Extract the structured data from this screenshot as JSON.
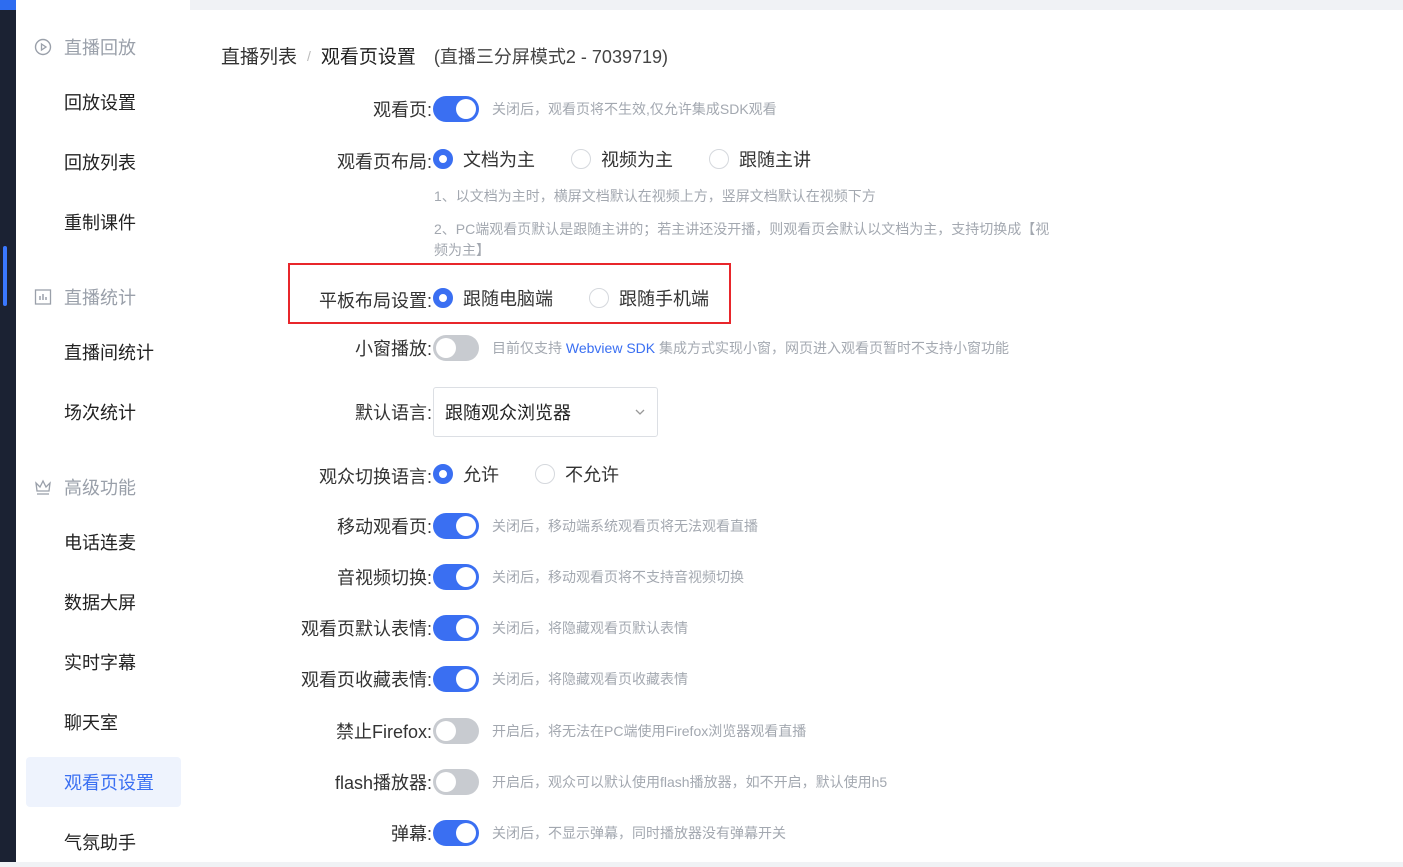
{
  "sidebar": {
    "groups": [
      {
        "label": "直播回放",
        "icon": "play-circle-icon"
      },
      {
        "label": "直播统计",
        "icon": "bar-chart-icon"
      },
      {
        "label": "高级功能",
        "icon": "crown-icon"
      }
    ],
    "items": [
      {
        "label": "回放设置"
      },
      {
        "label": "回放列表"
      },
      {
        "label": "重制课件"
      },
      {
        "label": "直播间统计"
      },
      {
        "label": "场次统计"
      },
      {
        "label": "电话连麦"
      },
      {
        "label": "数据大屏"
      },
      {
        "label": "实时字幕"
      },
      {
        "label": "聊天室"
      },
      {
        "label": "观看页设置",
        "active": true
      },
      {
        "label": "气氛助手"
      }
    ]
  },
  "breadcrumb": {
    "root": "直播列表",
    "separator": "/",
    "current": "观看页设置",
    "subtitle": "(直播三分屏模式2 - 7039719)"
  },
  "form": {
    "watch_page": {
      "label": "观看页:",
      "on": true,
      "hint": "关闭后，观看页将不生效,仅允许集成SDK观看"
    },
    "layout": {
      "label": "观看页布局:",
      "options": [
        "文档为主",
        "视频为主",
        "跟随主讲"
      ],
      "selected": "文档为主",
      "note1": "1、以文档为主时，横屏文档默认在视频上方，竖屏文档默认在视频下方",
      "note2": "2、PC端观看页默认是跟随主讲的；若主讲还没开播，则观看页会默认以文档为主，支持切换成【视频为主】"
    },
    "tablet_layout": {
      "label": "平板布局设置:",
      "options": [
        "跟随电脑端",
        "跟随手机端"
      ],
      "selected": "跟随电脑端"
    },
    "mini_window": {
      "label": "小窗播放:",
      "on": false,
      "hint_pre": "目前仅支持 ",
      "hint_link": "Webview SDK",
      "hint_post": " 集成方式实现小窗，网页进入观看页暂时不支持小窗功能"
    },
    "language": {
      "label": "默认语言:",
      "value": "跟随观众浏览器"
    },
    "switch_language": {
      "label": "观众切换语言:",
      "options": [
        "允许",
        "不允许"
      ],
      "selected": "允许"
    },
    "mobile_page": {
      "label": "移动观看页:",
      "on": true,
      "hint": "关闭后，移动端系统观看页将无法观看直播"
    },
    "av_switch": {
      "label": "音视频切换:",
      "on": true,
      "hint": "关闭后，移动观看页将不支持音视频切换"
    },
    "default_emoji": {
      "label": "观看页默认表情:",
      "on": true,
      "hint": "关闭后，将隐藏观看页默认表情"
    },
    "fav_emoji": {
      "label": "观看页收藏表情:",
      "on": true,
      "hint": "关闭后，将隐藏观看页收藏表情"
    },
    "firefox": {
      "label": "禁止Firefox:",
      "on": false,
      "hint": "开启后，将无法在PC端使用Firefox浏览器观看直播"
    },
    "flash": {
      "label": "flash播放器:",
      "on": false,
      "hint": "开启后，观众可以默认使用flash播放器，如不开启，默认使用h5"
    },
    "danmu": {
      "label": "弹幕:",
      "on": true,
      "hint": "关闭后，不显示弹幕，同时播放器没有弹幕开关"
    }
  },
  "colors": {
    "accent": "#3a6ff2",
    "highlight": "#e8262b",
    "dark_rail": "#1b2233"
  }
}
